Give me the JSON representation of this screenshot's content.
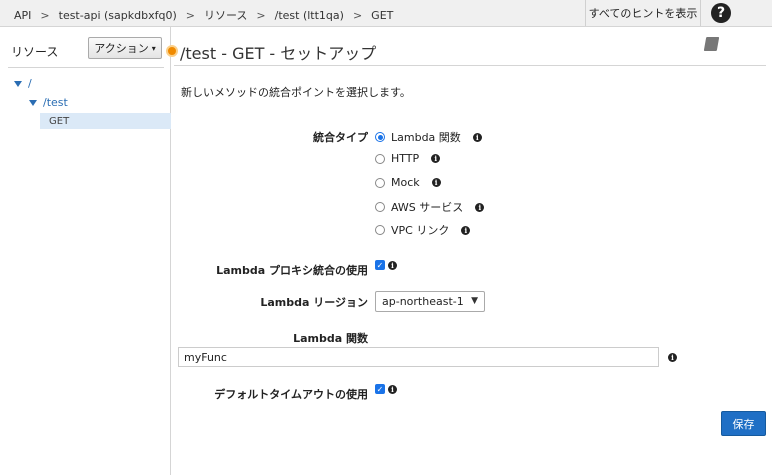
{
  "breadcrumbs": [
    "API",
    "test-api (sapkdbxfq0)",
    "リソース",
    "/test (ltt1qa)",
    "GET"
  ],
  "breadcrumb_separator": ">",
  "header": {
    "hints_label": "すべてのヒントを表示",
    "help_symbol": "?"
  },
  "sidebar": {
    "title": "リソース",
    "action_label": "アクション",
    "tree": [
      {
        "label": "/"
      },
      {
        "label": "/test"
      },
      {
        "label": "GET",
        "selected": true
      }
    ]
  },
  "main": {
    "title": "/test - GET - セットアップ",
    "intro": "新しいメソッドの統合ポイントを選択します。",
    "integration_type_label": "統合タイプ",
    "integration_options": [
      {
        "label": "Lambda 関数",
        "checked": true
      },
      {
        "label": "HTTP",
        "checked": false
      },
      {
        "label": "Mock",
        "checked": false
      },
      {
        "label": "AWS サービス",
        "checked": false
      },
      {
        "label": "VPC リンク",
        "checked": false
      }
    ],
    "proxy_label": "Lambda プロキシ統合の使用",
    "proxy_checked": true,
    "region_label": "Lambda リージョン",
    "region_value": "ap-northeast-1",
    "function_label": "Lambda 関数",
    "function_value": "myFunc",
    "timeout_label": "デフォルトタイムアウトの使用",
    "timeout_checked": true,
    "save_label": "保存"
  },
  "colors": {
    "accent": "#1a73e8",
    "save_button": "#1f6fc5",
    "marker": "#f08a00",
    "tree_link": "#2a6db3"
  }
}
